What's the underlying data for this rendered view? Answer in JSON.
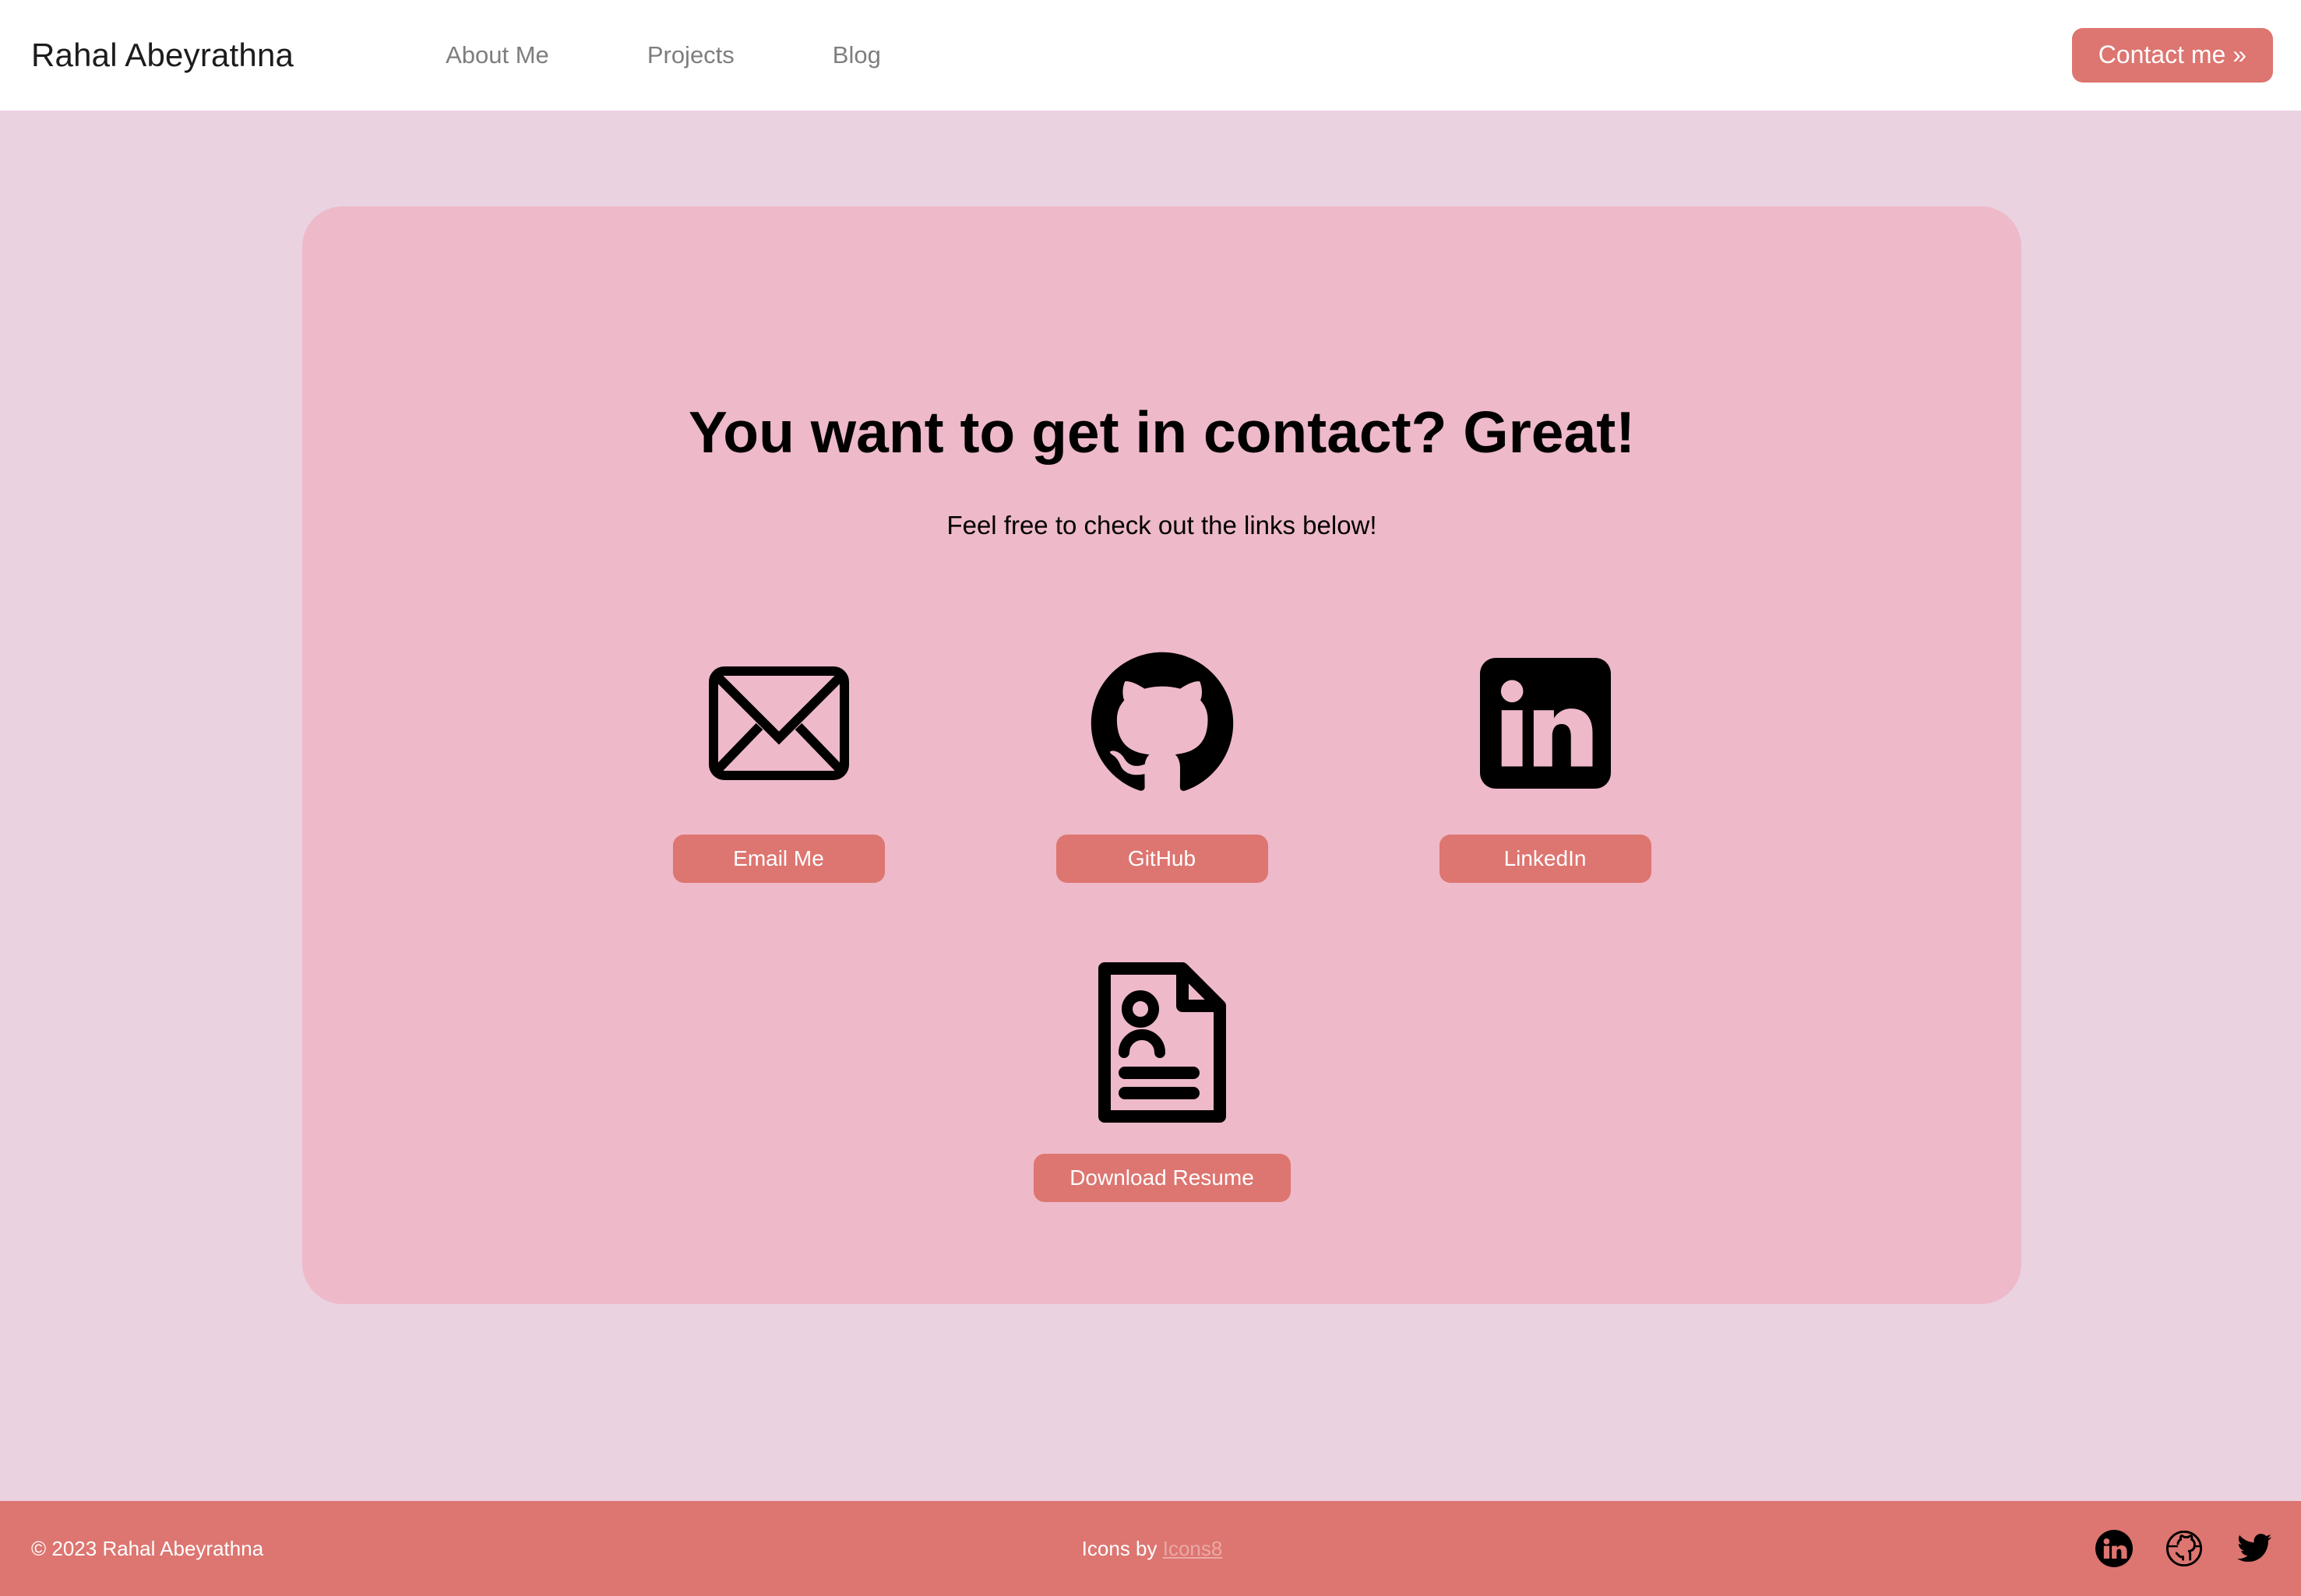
{
  "navbar": {
    "brand": "Rahal Abeyrathna",
    "links": [
      {
        "label": "About Me",
        "icon": "nav-link-icon"
      },
      {
        "label": "Projects",
        "icon": "nav-link-icon"
      },
      {
        "label": "Blog",
        "icon": "nav-link-icon"
      }
    ],
    "cta_label": "Contact me »"
  },
  "main": {
    "title": "You want to get in contact? Great!",
    "subtitle": "Feel free to check out the links below!",
    "links": [
      {
        "label": "Email Me",
        "icon": "envelope-icon"
      },
      {
        "label": "GitHub",
        "icon": "github-icon"
      },
      {
        "label": "LinkedIn",
        "icon": "linkedin-icon"
      }
    ],
    "resume": {
      "label": "Download Resume",
      "icon": "resume-document-icon"
    }
  },
  "footer": {
    "copyright": "© 2023 Rahal Abeyrathna",
    "credit_prefix": "Icons by ",
    "credit_link": "Icons8",
    "social": [
      {
        "name": "linkedin-icon"
      },
      {
        "name": "github-icon"
      },
      {
        "name": "twitter-icon"
      }
    ]
  },
  "colors": {
    "accent": "#dd7570",
    "page_bg": "#ead2e1",
    "card_bg": "#eeb9c9",
    "navbar_bg": "#ffffff",
    "nav_text": "#7e7e7e",
    "icon_black": "#000000",
    "footer_text": "#ffffff",
    "footer_link": "#eaa9a6"
  }
}
